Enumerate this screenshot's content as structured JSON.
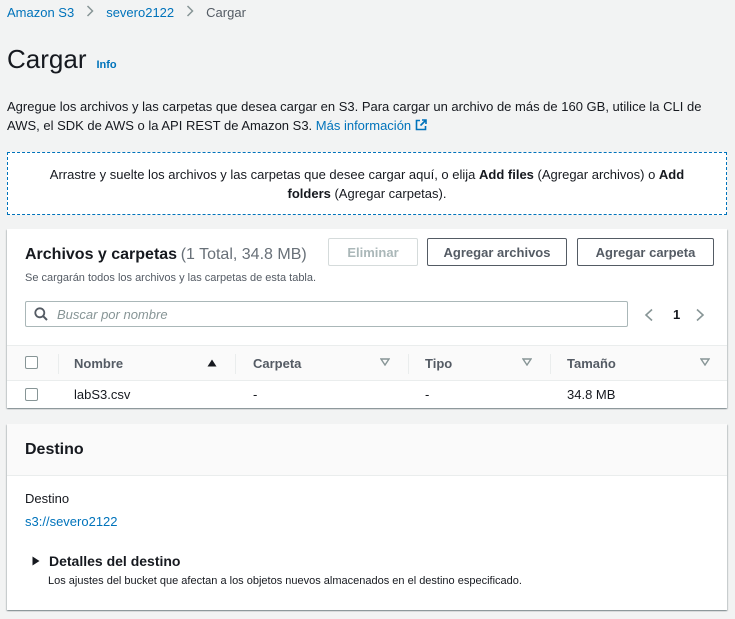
{
  "breadcrumb": {
    "items": [
      "Amazon S3",
      "severo2122"
    ],
    "current": "Cargar"
  },
  "header": {
    "title": "Cargar",
    "info": "Info"
  },
  "description": {
    "text": "Agregue los archivos y las carpetas que desea cargar en S3. Para cargar un archivo de más de 160 GB, utilice la CLI de AWS, el SDK de AWS o la API REST de Amazon S3. ",
    "link": "Más información"
  },
  "dropzone": {
    "part1": "Arrastre y suelte los archivos y las carpetas que desee cargar aquí, o elija ",
    "add_files": "Add files",
    "part2": " (Agregar archivos) o ",
    "add_folders": "Add folders",
    "part3": " (Agregar carpetas)."
  },
  "files": {
    "title": "Archivos y carpetas",
    "count": "(1 Total, 34.8 MB)",
    "subtitle": "Se cargarán todos los archivos y las carpetas de esta tabla.",
    "buttons": {
      "remove": "Eliminar",
      "add_files": "Agregar archivos",
      "add_folder": "Agregar carpeta"
    },
    "search_placeholder": "Buscar por nombre",
    "page": "1",
    "columns": [
      "Nombre",
      "Carpeta",
      "Tipo",
      "Tamaño"
    ],
    "rows": [
      {
        "name": "labS3.csv",
        "folder": "-",
        "type": "-",
        "size": "34.8 MB"
      }
    ]
  },
  "destination": {
    "title": "Destino",
    "label": "Destino",
    "link": "s3://severo2122",
    "details_title": "Detalles del destino",
    "details_desc": "Los ajustes del bucket que afectan a los objetos nuevos almacenados en el destino especificado."
  },
  "colors": {
    "link": "#0073bb",
    "background": "#f2f3f3",
    "border": "#545b64"
  }
}
